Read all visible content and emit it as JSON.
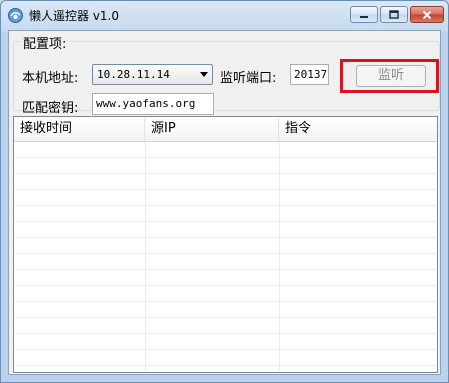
{
  "window": {
    "title": "懒人遥控器 v1.0"
  },
  "config": {
    "group_label": "配置项:",
    "local_addr_label": "本机地址:",
    "local_addr_value": "10.28.11.14",
    "port_label": "监听端口:",
    "port_value": "20137",
    "listen_button": "监听",
    "key_label": "匹配密钥:",
    "key_value": "www.yaofans.org"
  },
  "table": {
    "columns": [
      "接收时间",
      "源IP",
      "指令"
    ]
  },
  "colors": {
    "highlight": "#d6141b",
    "close_button": "#c4412a"
  }
}
